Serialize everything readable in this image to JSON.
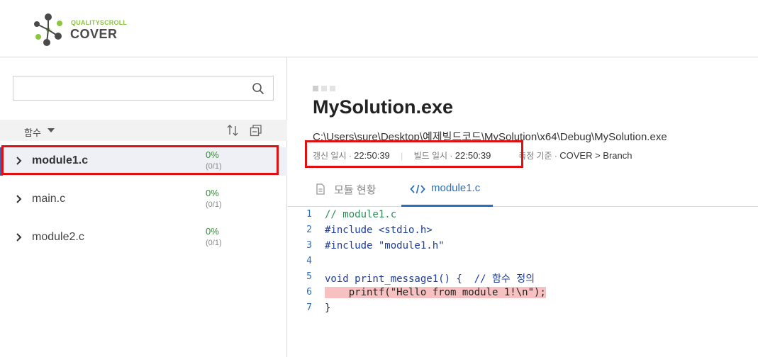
{
  "logo": {
    "small": "QUALITYSCROLL",
    "big": "COVER"
  },
  "sidebar": {
    "search": {
      "value": "",
      "placeholder": ""
    },
    "column_label": "함수",
    "files": [
      {
        "name": "module1.c",
        "percent": "0%",
        "fraction": "(0/1)",
        "selected": true
      },
      {
        "name": "main.c",
        "percent": "0%",
        "fraction": "(0/1)",
        "selected": false
      },
      {
        "name": "module2.c",
        "percent": "0%",
        "fraction": "(0/1)",
        "selected": false
      }
    ]
  },
  "main": {
    "title": "MySolution.exe",
    "path": "C:\\Users\\sure\\Desktop\\예제빌드코드\\MySolution\\x64\\Debug\\MySolution.exe",
    "meta": {
      "updated_label": "갱신 일시 ·",
      "updated_value": "22:50:39",
      "build_label": "빌드 일시 ·",
      "build_value": "22:50:39",
      "criteria_label": "측정 기준 ·",
      "criteria_value": "COVER > Branch"
    },
    "tabs": [
      {
        "label": "모듈 현황",
        "active": false
      },
      {
        "label": "module1.c",
        "active": true
      }
    ]
  },
  "code": {
    "lines": [
      {
        "n": "1",
        "text": "// module1.c"
      },
      {
        "n": "2",
        "text": "#include <stdio.h>"
      },
      {
        "n": "3",
        "text": "#include \"module1.h\""
      },
      {
        "n": "4",
        "text": ""
      },
      {
        "n": "5",
        "text": "void print_message1() {  // 함수 정의"
      },
      {
        "n": "6",
        "text": "    printf(\"Hello from module 1!\\n\");",
        "highlight": true
      },
      {
        "n": "7",
        "text": "}"
      }
    ]
  },
  "colors": {
    "accent": "#2a6ebc",
    "coverage_green": "#3a8a3a",
    "uncovered_highlight": "#f8c1c1",
    "annotation_red": "#e01010"
  }
}
